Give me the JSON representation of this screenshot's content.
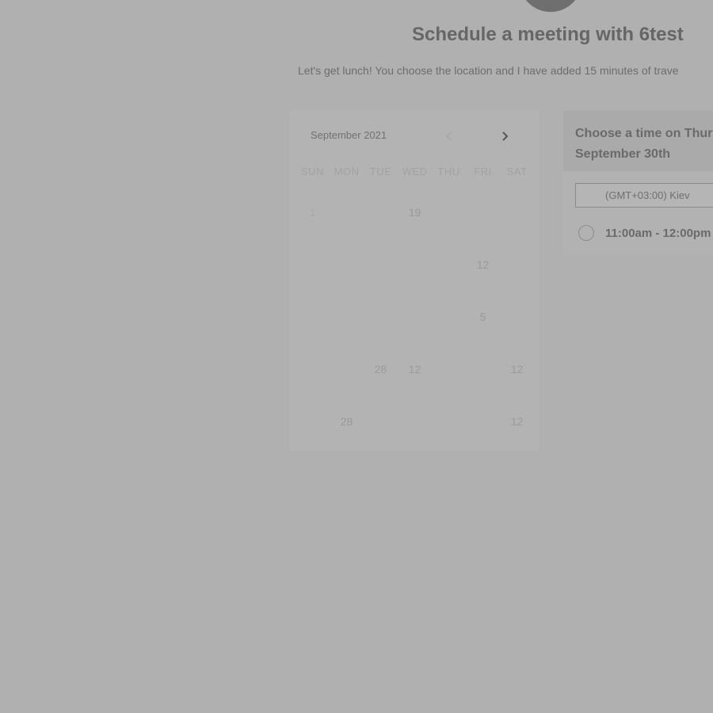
{
  "header": {
    "title": "Schedule a meeting with 6test",
    "subtitle": "Let's get lunch! You choose the location and I have added 15 minutes of trave"
  },
  "calendar": {
    "month": "September 2021",
    "weekdays": [
      "SUN",
      "MON",
      "TUE",
      "WED",
      "THU",
      "FRI",
      "SAT"
    ],
    "rows": [
      [
        "1",
        "",
        "",
        "19",
        "",
        "",
        ""
      ],
      [
        "",
        "",
        "",
        "",
        "",
        "12",
        ""
      ],
      [
        "",
        "",
        "",
        "",
        "",
        "5",
        ""
      ],
      [
        "",
        "",
        "28",
        "12",
        "",
        "",
        "12"
      ],
      [
        "",
        "28",
        "",
        "",
        "",
        "",
        "12"
      ]
    ]
  },
  "time_panel": {
    "header_line1": "Choose a time on Thurs",
    "header_line2": "September 30th",
    "timezone": "(GMT+03:00) Kiev",
    "slots": [
      "11:00am - 12:00pm"
    ]
  }
}
